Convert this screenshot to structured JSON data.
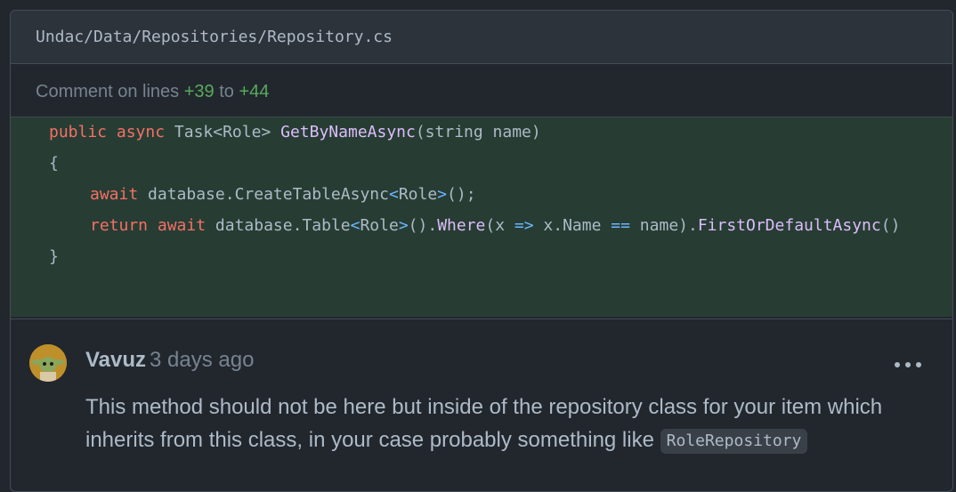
{
  "file": {
    "path": "Undac/Data/Repositories/Repository.cs"
  },
  "comment_range": {
    "prefix": "Comment on lines",
    "start": "+39",
    "conjunction": "to",
    "end": "+44"
  },
  "code": {
    "line1": {
      "public": "public",
      "async": "async",
      "ret": "Task<Role>",
      "name": "GetByNameAsync",
      "params": "(string name)"
    },
    "line2": "{",
    "line3": {
      "await": "await",
      "rest_a": "database.CreateTableAsync",
      "lt": "<",
      "type": "Role",
      "gt": ">",
      "rest_b": "();"
    },
    "line4": {
      "return": "return",
      "await": "await",
      "a": "database.Table",
      "lt": "<",
      "type": "Role",
      "gt": ">",
      "b": "().",
      "where": "Where",
      "c": "(x ",
      "arrow": "=>",
      "d": " x.Name ",
      "eq": "==",
      "e": " name).",
      "first": "FirstOrDefaultAsync",
      "f": "()"
    },
    "line5": "}"
  },
  "review_comment": {
    "author": "Vavuz",
    "time": "3 days ago",
    "body": "This method should not be here but inside of the repository class for your item which inherits from this class, in your case probably something like",
    "inline_code": "RoleRepository"
  },
  "icons": {
    "more": "kebab-horizontal-icon",
    "avatar": "user-avatar"
  }
}
